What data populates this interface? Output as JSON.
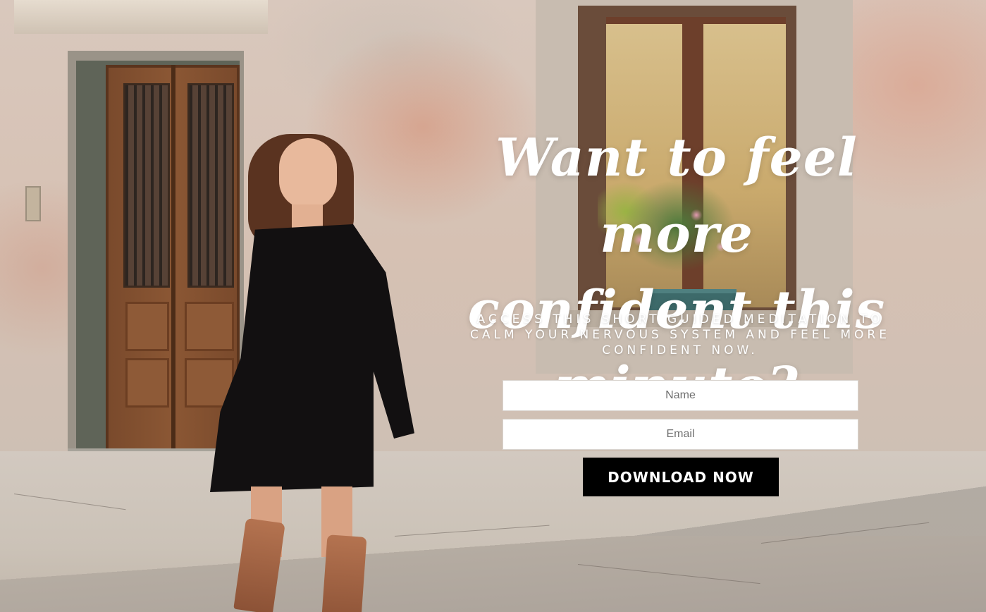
{
  "hero": {
    "background_description_icon": "street-photo",
    "headline": "Want to feel more confident this minute?",
    "subheadline": "ACCESS THIS SHORT GUIDED MEDITATION TO CALM YOUR NERVOUS SYSTEM AND FEEL MORE CONFIDENT NOW."
  },
  "form": {
    "name_placeholder": "Name",
    "name_value": "",
    "email_placeholder": "Email",
    "email_value": "",
    "submit_label": "DOWNLOAD NOW"
  },
  "colors": {
    "button_bg": "#000000",
    "button_text": "#ffffff",
    "text_on_image": "#ffffff",
    "field_bg": "#ffffff"
  }
}
